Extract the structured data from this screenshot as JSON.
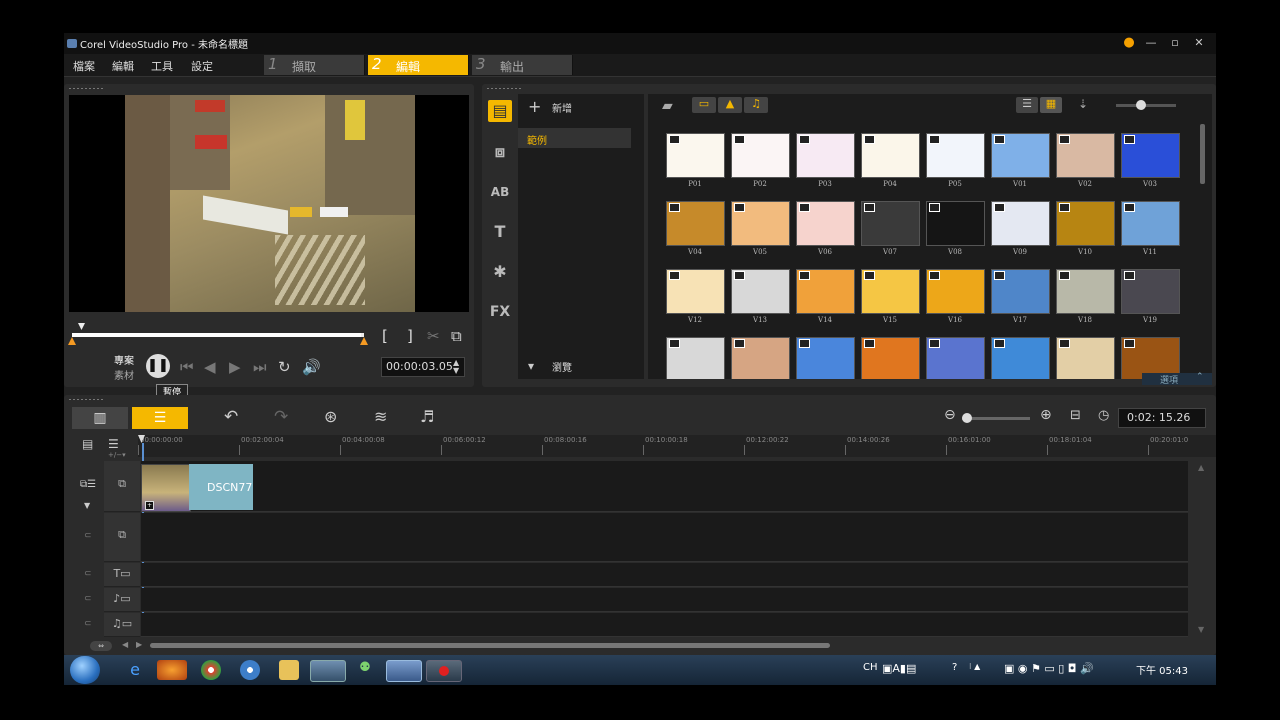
{
  "window": {
    "title": "Corel VideoStudio Pro - 未命名標題"
  },
  "menu": {
    "items": [
      "檔案",
      "編輯",
      "工具",
      "設定"
    ]
  },
  "steps": [
    {
      "num": "1",
      "label": "擷取"
    },
    {
      "num": "2",
      "label": "編輯"
    },
    {
      "num": "3",
      "label": "輸出"
    }
  ],
  "player": {
    "mode_project": "專案",
    "mode_clip": "素材",
    "pause_tooltip": "暫停",
    "timecode": "00:00:03.05",
    "progress": 0.99
  },
  "library": {
    "add_label": "新增",
    "folders": [
      "範例"
    ],
    "browse_label": "瀏覽",
    "options_label": "選項",
    "thumbnails": [
      {
        "label": "P01",
        "color": "#fbf7ee"
      },
      {
        "label": "P02",
        "color": "#fbf5f5"
      },
      {
        "label": "P03",
        "color": "#f7eaf3"
      },
      {
        "label": "P04",
        "color": "#fbf6ea"
      },
      {
        "label": "P05",
        "color": "#f2f5fb"
      },
      {
        "label": "V01",
        "color": "#7fb0e8"
      },
      {
        "label": "V02",
        "color": "#d9b9a3"
      },
      {
        "label": "V03",
        "color": "#2a4fd8"
      },
      {
        "label": "V04",
        "color": "#c68a2a"
      },
      {
        "label": "V05",
        "color": "#f2bb7e"
      },
      {
        "label": "V06",
        "color": "#f6d3cd"
      },
      {
        "label": "V07",
        "color": "#3a3a3a"
      },
      {
        "label": "V08",
        "color": "#151515"
      },
      {
        "label": "V09",
        "color": "#e4e8f2"
      },
      {
        "label": "V10",
        "color": "#b78512"
      },
      {
        "label": "V11",
        "color": "#6fa2d8"
      },
      {
        "label": "V12",
        "color": "#f7e2b5"
      },
      {
        "label": "V13",
        "color": "#d8d8d8"
      },
      {
        "label": "V14",
        "color": "#f0a13a"
      },
      {
        "label": "V15",
        "color": "#f5c644"
      },
      {
        "label": "V16",
        "color": "#eda719"
      },
      {
        "label": "V17",
        "color": "#4f86c9"
      },
      {
        "label": "V18",
        "color": "#b8b8a8"
      },
      {
        "label": "V19",
        "color": "#4a4850"
      },
      {
        "label": "",
        "color": "#d8d8d8"
      },
      {
        "label": "",
        "color": "#d6a583"
      },
      {
        "label": "",
        "color": "#4a86dc"
      },
      {
        "label": "",
        "color": "#e0761f"
      },
      {
        "label": "",
        "color": "#5a74cf"
      },
      {
        "label": "",
        "color": "#3f8ad8"
      },
      {
        "label": "",
        "color": "#e3cfa6"
      },
      {
        "label": "",
        "color": "#9a5414"
      }
    ]
  },
  "timeline": {
    "total_time": "0:02: 15.26",
    "ruler_ticks": [
      "00:00:00:00",
      "00:02:00:04",
      "00:04:00:08",
      "00:06:00:12",
      "00:08:00:16",
      "00:10:00:18",
      "00:12:00:22",
      "00:14:00:26",
      "00:16:01:00",
      "00:18:01:04",
      "00:20:01:0"
    ],
    "clip_label": "DSCN77"
  },
  "taskbar": {
    "lang": "CH",
    "time": "下午 05:43"
  }
}
